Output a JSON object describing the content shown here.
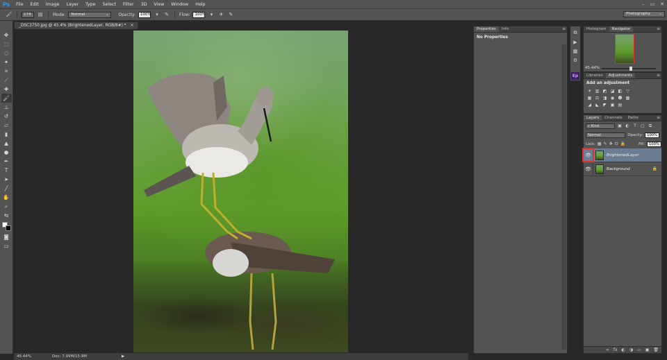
{
  "app": {
    "logo": "Ps",
    "window_controls": [
      "–",
      "▭",
      "✕"
    ]
  },
  "menu": [
    "File",
    "Edit",
    "Image",
    "Layer",
    "Type",
    "Select",
    "Filter",
    "3D",
    "View",
    "Window",
    "Help"
  ],
  "options": {
    "brush_size": "174",
    "mode_label": "Mode:",
    "mode_value": "Normal",
    "opacity_label": "Opacity:",
    "opacity_value": "100%",
    "flow_label": "Flow:",
    "flow_value": "100%",
    "workspace": "Photography"
  },
  "document": {
    "tab_title": "_DSC3750.jpg @ 45.4% (BrightenedLayer, RGB/8#) *",
    "close": "×"
  },
  "status": {
    "zoom": "45.44%",
    "doc": "Doc: 7.99M/15.9M"
  },
  "properties": {
    "tabs": [
      "Properties",
      "Info"
    ],
    "content": "No Properties"
  },
  "navigator": {
    "tabs": [
      "Histogram",
      "Navigator"
    ],
    "zoom": "45.44%"
  },
  "adjustments": {
    "tabs": [
      "Libraries",
      "Adjustments"
    ],
    "title": "Add an adjustment",
    "icons_row1": [
      "☀",
      "▥",
      "◩",
      "◪",
      "◧",
      "▽"
    ],
    "icons_row2": [
      "▦",
      "⚖",
      "◨",
      "◉",
      "☻",
      "▩"
    ],
    "icons_row3": [
      "◢",
      "◣",
      "◤",
      "▣",
      "▤"
    ]
  },
  "layers": {
    "tabs": [
      "Layers",
      "Channels",
      "Paths"
    ],
    "filter_kind": "Kind",
    "blend_mode": "Normal",
    "opacity_label": "Opacity:",
    "opacity_value": "100%",
    "lock_label": "Lock:",
    "fill_label": "Fill:",
    "fill_value": "100%",
    "items": [
      {
        "name": "BrightenedLayer",
        "selected": true,
        "locked": false
      },
      {
        "name": "Background",
        "selected": false,
        "locked": true
      }
    ],
    "footer_icons": [
      "∞",
      "fx",
      "◐",
      "◑",
      "▭",
      "▣",
      "🗑"
    ]
  },
  "colors": {
    "foreground": "#ffffff",
    "background": "#000000",
    "highlight": "#e0342b",
    "selected_layer": "#6c7c93"
  }
}
